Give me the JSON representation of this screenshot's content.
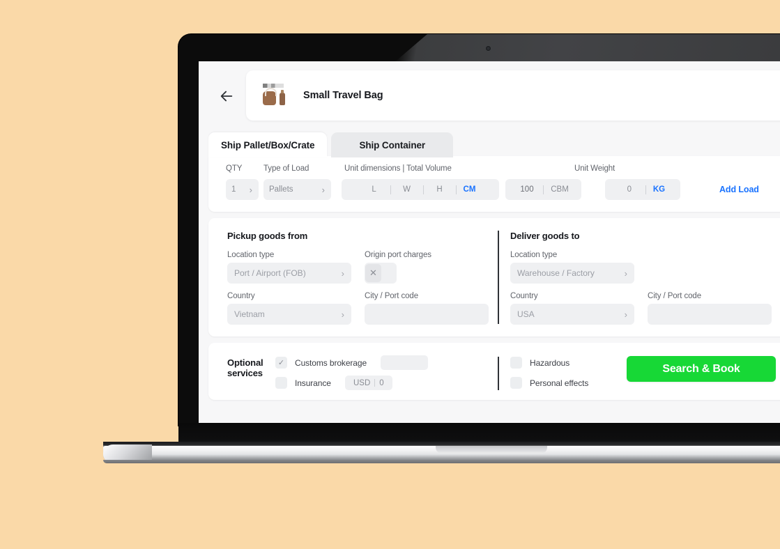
{
  "header": {
    "back_icon": "arrow-left-icon",
    "product_title": "Small Travel Bag",
    "thumb_icon": "travel-bag-thumbnail"
  },
  "tabs": [
    {
      "label": "Ship Pallet/Box/Crate",
      "active": true
    },
    {
      "label": "Ship Container",
      "active": false
    }
  ],
  "load": {
    "labels": {
      "qty": "QTY",
      "type_of_load": "Type of Load",
      "unit_dimensions": "Unit dimensions | Total Volume",
      "unit_weight": "Unit Weight"
    },
    "qty_value": "1",
    "type_value": "Pallets",
    "dim_l": "L",
    "dim_w": "W",
    "dim_h": "H",
    "dim_unit": "CM",
    "volume_value": "100",
    "volume_unit": "CBM",
    "weight_value": "0",
    "weight_unit": "KG",
    "add_load_label": "Add Load"
  },
  "pickup": {
    "title": "Pickup goods from",
    "location_type_label": "Location type",
    "location_type_value": "Port / Airport (FOB)",
    "origin_charges_label": "Origin port charges",
    "origin_charges_icon": "close-icon",
    "country_label": "Country",
    "country_value": "Vietnam",
    "city_label": "City / Port code",
    "city_value": ""
  },
  "deliver": {
    "title": "Deliver goods to",
    "location_type_label": "Location type",
    "location_type_value": "Warehouse / Factory",
    "country_label": "Country",
    "country_value": "USA",
    "city_label": "City / Port code",
    "city_value": ""
  },
  "optional": {
    "title_line1": "Optional",
    "title_line2": "services",
    "customs_label": "Customs brokerage",
    "customs_checked": true,
    "customs_check_glyph": "✓",
    "customs_amount": "",
    "insurance_label": "Insurance",
    "insurance_checked": false,
    "insurance_currency": "USD",
    "insurance_amount": "0",
    "hazardous_label": "Hazardous",
    "hazardous_checked": false,
    "personal_effects_label": "Personal effects",
    "personal_effects_checked": false,
    "search_button": "Search & Book"
  },
  "colors": {
    "background": "#fad9a8",
    "accent_blue": "#1a73ff",
    "accent_green": "#17d836",
    "field_gray": "#eff0f2"
  }
}
